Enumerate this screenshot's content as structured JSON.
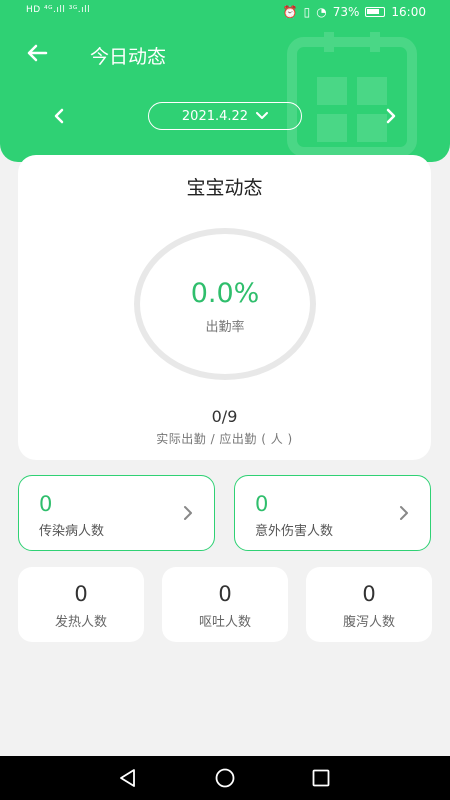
{
  "status_bar": {
    "left": "HD ⁴ᴳ.ıll ³ᴳ.ıll",
    "battery_percent": "73%",
    "time": "16:00",
    "icons": [
      "alarm-icon",
      "vibrate-icon",
      "speed-icon",
      "battery-icon"
    ]
  },
  "header": {
    "title": "今日动态",
    "date": "2021.4.22",
    "accent": "#2fd174"
  },
  "main_card": {
    "title": "宝宝动态",
    "attendance_rate": "0.0%",
    "attendance_label": "出勤率",
    "attendance_fraction": 0.0,
    "ratio": "0/9",
    "ratio_label": "实际出勤 / 应出勤 ( 人 )"
  },
  "stats": [
    {
      "value": "0",
      "label": "传染病人数"
    },
    {
      "value": "0",
      "label": "意外伤害人数"
    }
  ],
  "small_stats": [
    {
      "value": "0",
      "label": "发热人数"
    },
    {
      "value": "0",
      "label": "呕吐人数"
    },
    {
      "value": "0",
      "label": "腹泻人数"
    }
  ],
  "navbar": {
    "icons": [
      "back-triangle-icon",
      "home-circle-icon",
      "recent-square-icon"
    ]
  }
}
